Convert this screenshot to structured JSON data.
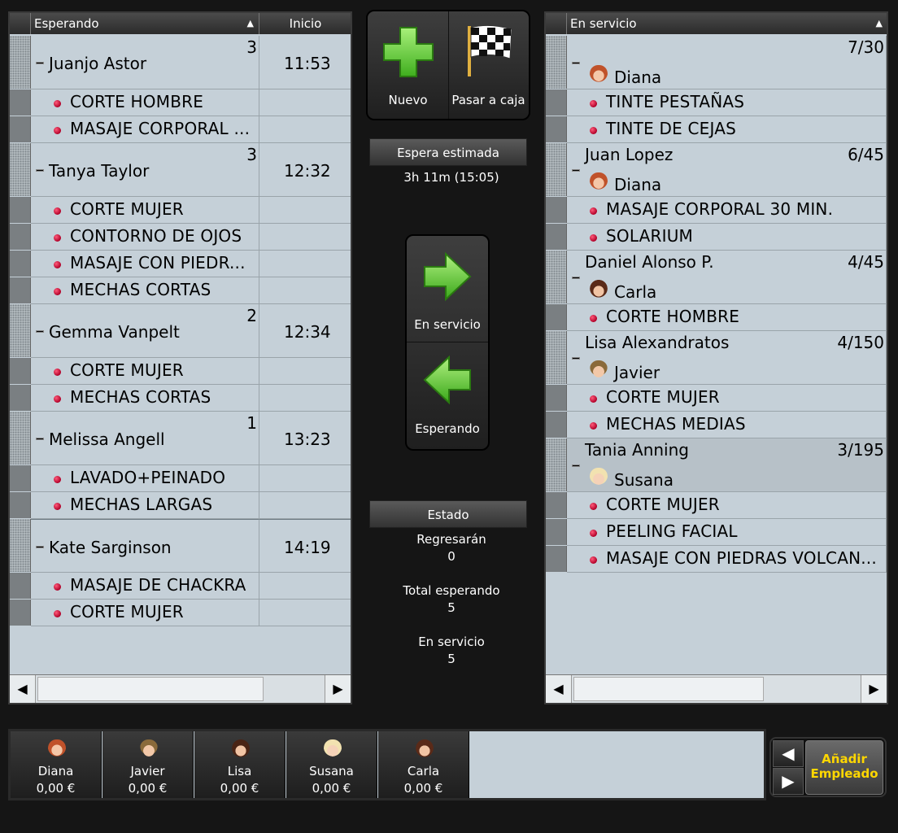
{
  "waiting": {
    "header_name": "Esperando",
    "header_time": "Inicio",
    "clients": [
      {
        "name": "Juanjo Astor",
        "count": "3",
        "time": "11:53",
        "services": [
          "CORTE HOMBRE",
          "MASAJE CORPORAL ..."
        ]
      },
      {
        "name": "Tanya Taylor",
        "count": "3",
        "time": "12:32",
        "services": [
          "CORTE MUJER",
          "CONTORNO DE OJOS",
          "MASAJE CON PIEDR...",
          "MECHAS CORTAS"
        ]
      },
      {
        "name": "Gemma Vanpelt",
        "count": "2",
        "time": "12:34",
        "services": [
          "CORTE MUJER",
          "MECHAS CORTAS"
        ]
      },
      {
        "name": "Melissa Angell",
        "count": "1",
        "time": "13:23",
        "services": [
          "LAVADO+PEINADO",
          "MECHAS LARGAS"
        ]
      },
      {
        "name": "Kate Sarginson",
        "count": "",
        "time": "14:19",
        "services": [
          "MASAJE DE CHACKRA",
          "CORTE MUJER"
        ]
      }
    ]
  },
  "in_service": {
    "header_name": "En servicio",
    "clients": [
      {
        "name": "",
        "progress": "7/30",
        "employee": "Diana",
        "services": [
          "TINTE PESTAÑAS",
          "TINTE DE CEJAS"
        ]
      },
      {
        "name": "Juan Lopez",
        "progress": "6/45",
        "employee": "Diana",
        "services": [
          "MASAJE CORPORAL 30 MIN.",
          "SOLARIUM"
        ]
      },
      {
        "name": "Daniel Alonso P.",
        "progress": "4/45",
        "employee": "Carla",
        "services": [
          "CORTE HOMBRE"
        ]
      },
      {
        "name": "Lisa Alexandratos",
        "progress": "4/150",
        "employee": "Javier",
        "services": [
          "CORTE MUJER",
          "MECHAS MEDIAS"
        ]
      },
      {
        "name": "Tania Anning",
        "progress": "3/195",
        "employee": "Susana",
        "services": [
          "CORTE MUJER",
          "PEELING FACIAL",
          "MASAJE CON PIEDRAS VOLCAN..."
        ]
      }
    ]
  },
  "toolbar": {
    "new_label": "Nuevo",
    "checkout_label": "Pasar a caja"
  },
  "estimate": {
    "label": "Espera estimada",
    "value": "3h 11m (15:05)"
  },
  "move": {
    "to_service_label": "En servicio",
    "to_waiting_label": "Esperando"
  },
  "status": {
    "title": "Estado",
    "items": [
      {
        "label": "Regresarán",
        "value": "0"
      },
      {
        "label": "Total esperando",
        "value": "5"
      },
      {
        "label": "En servicio",
        "value": "5"
      }
    ]
  },
  "employees": [
    {
      "name": "Diana",
      "amount": "0,00 €"
    },
    {
      "name": "Javier",
      "amount": "0,00 €"
    },
    {
      "name": "Lisa",
      "amount": "0,00 €"
    },
    {
      "name": "Susana",
      "amount": "0,00 €"
    },
    {
      "name": "Carla",
      "amount": "0,00 €"
    }
  ],
  "add_employee": {
    "line1": "Añadir",
    "line2": "Empleado"
  },
  "colors": {
    "panel_bg": "#c5d0d8",
    "accent_yellow": "#ffd700",
    "service_dot": "#c4003a",
    "button_green": "#6fcf3a"
  }
}
